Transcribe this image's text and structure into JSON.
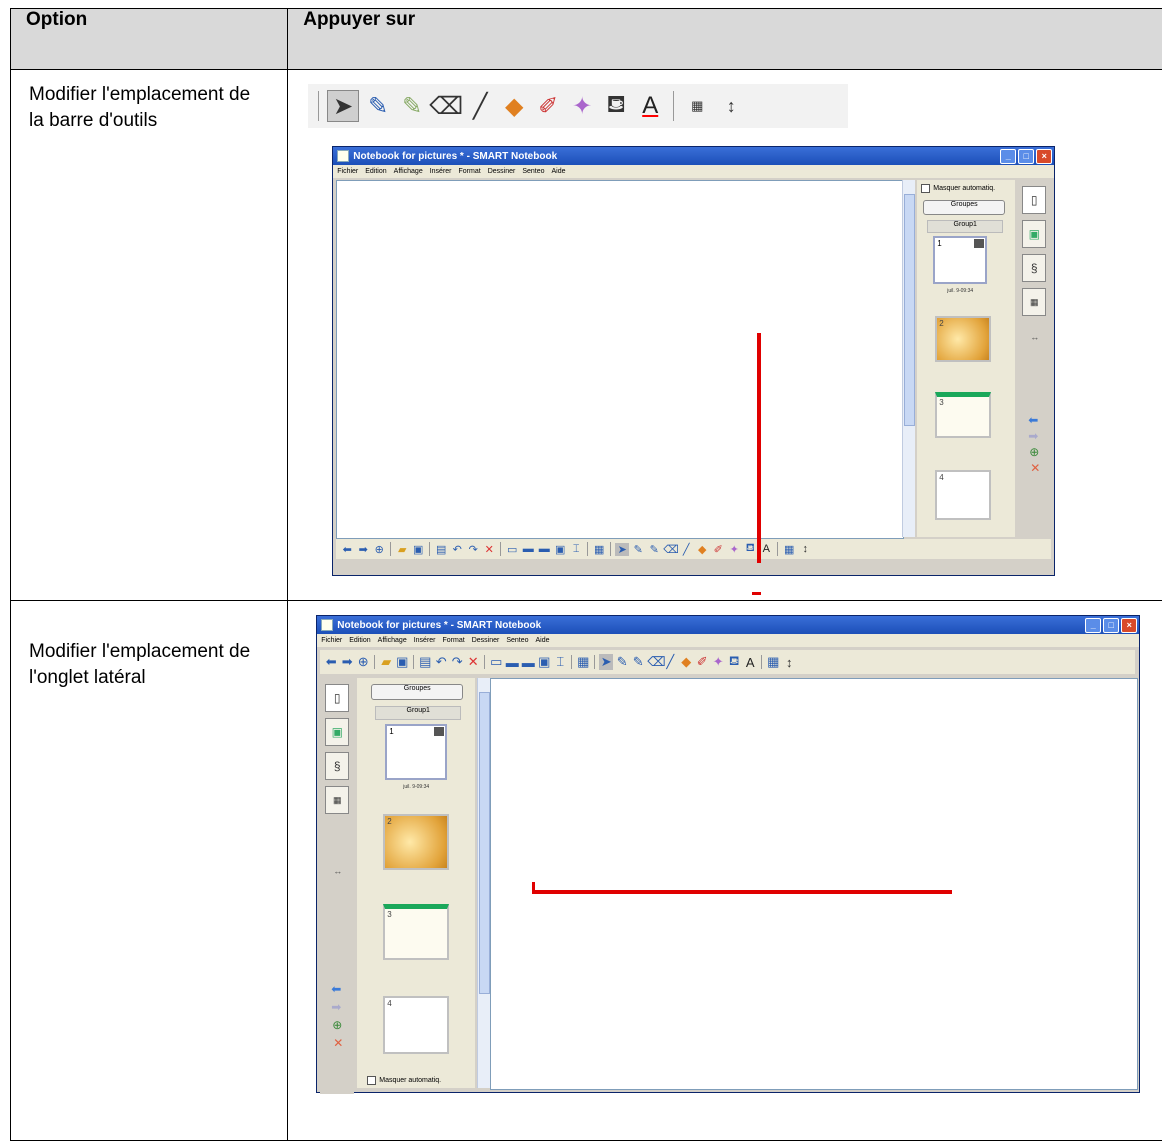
{
  "headers": {
    "option": "Option",
    "press": "Appuyer sur"
  },
  "rows": [
    {
      "option": "Modifier l'emplacement de la barre d'outils"
    },
    {
      "option": "Modifier l'emplacement de l'onglet latéral"
    }
  ],
  "window": {
    "title": "Notebook for pictures * - SMART Notebook",
    "menu": [
      "Fichier",
      "Edition",
      "Affichage",
      "Insérer",
      "Format",
      "Dessiner",
      "Senteo",
      "Aide"
    ],
    "hide_auto": "Masquer automatiq.",
    "groups_button": "Groupes",
    "group_name": "Group1",
    "page1_num": "1",
    "page1_date": "juil. 9-09:34",
    "page2_num": "2",
    "page3_num": "3",
    "page4_num": "4"
  },
  "colors": {
    "header_bg": "#d9d9d9",
    "highlight": "#e00000",
    "titlebar": "#1c4fb8"
  }
}
